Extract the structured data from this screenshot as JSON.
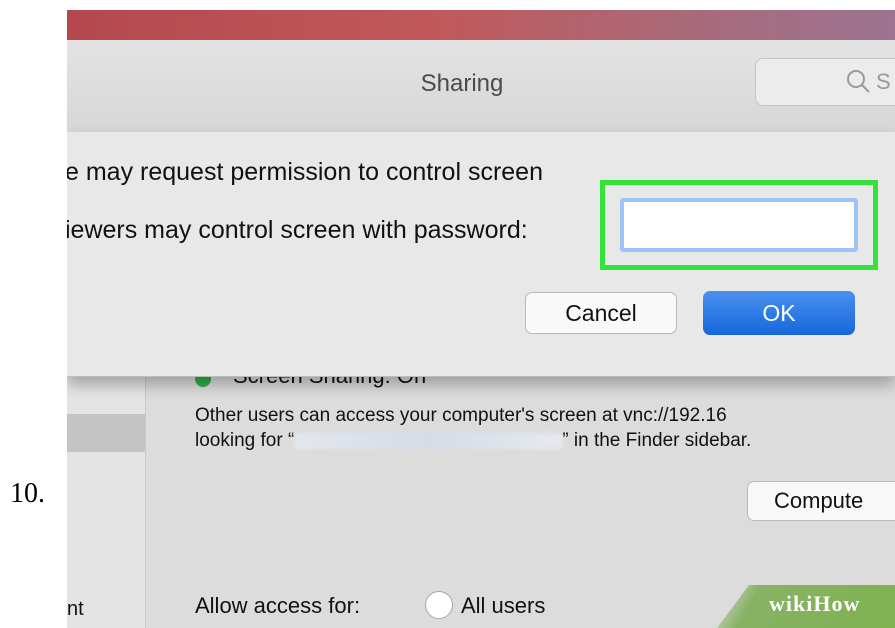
{
  "step": {
    "number": "10."
  },
  "window": {
    "title": "Sharing",
    "search_placeholder": "S"
  },
  "dialog": {
    "line1": "e may request permission to control screen",
    "line2": "iewers may control screen with password:",
    "password_value": "",
    "cancel_label": "Cancel",
    "ok_label": "OK"
  },
  "service": {
    "status_text": "Screen Sharing: On",
    "status_dot_color": "#2db144",
    "desc_line1": "Other users can access your computer's screen at vnc://192.16",
    "desc_prefix": "looking for “",
    "desc_suffix": "” in the Finder sidebar.",
    "computer_settings_label": "Compute",
    "allow_access_label": "Allow access for:",
    "all_users_label": "All users"
  },
  "sidebar": {
    "partial_label": "nt"
  },
  "watermark": {
    "text": "wikiHow",
    "color": "#7fb24f"
  },
  "colors": {
    "highlight": "#35e23a",
    "ok_blue": "#1667dc"
  }
}
